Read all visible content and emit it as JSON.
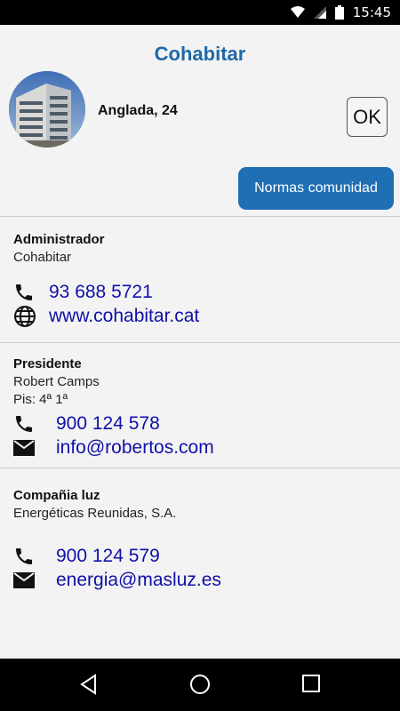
{
  "status_bar": {
    "time": "15:45"
  },
  "header": {
    "title": "Cohabitar",
    "address": "Anglada, 24",
    "ok_label": "OK",
    "rules_button": "Normas comunidad"
  },
  "sections": [
    {
      "heading": "Administrador",
      "lines": [
        "Cohabitar"
      ],
      "phone": "93 688 5721",
      "web": "www.cohabitar.cat"
    },
    {
      "heading": "Presidente",
      "lines": [
        "Robert Camps",
        "Pis: 4ª 1ª"
      ],
      "phone": "900 124 578",
      "email": "info@robertos.com"
    },
    {
      "heading": "Compañia luz",
      "lines": [
        "Energéticas Reunidas, S.A."
      ],
      "phone": "900 124 579",
      "email": "energia@masluz.es"
    }
  ],
  "colors": {
    "title": "#1f68a8",
    "accent_button": "#1f6fb5",
    "link": "#1010a8"
  }
}
